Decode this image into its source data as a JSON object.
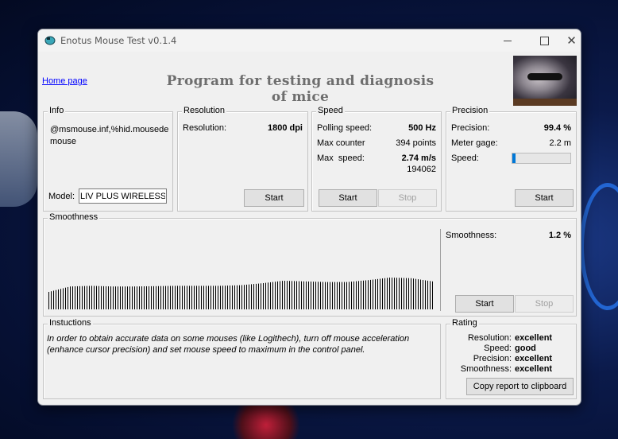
{
  "window": {
    "title": "Enotus Mouse Test v0.1.4",
    "icon": "mouse-icon"
  },
  "header": {
    "home_link": "Home page",
    "headline": "Program for testing and diagnosis of mice",
    "image": "raccoon-photo"
  },
  "info": {
    "title": "Info",
    "device": "@msmouse.inf,%hid.mousede mouse",
    "model_label": "Model:",
    "model_value": "LIV PLUS WIRELESS"
  },
  "resolution": {
    "title": "Resolution",
    "label": "Resolution:",
    "value": "1800 dpi",
    "start": "Start"
  },
  "speed": {
    "title": "Speed",
    "polling_label": "Polling speed:",
    "polling_value": "500 Hz",
    "counter_label": "Max counter",
    "counter_value": "394 points",
    "max_label": "Max  speed:",
    "max_value": "2.74 m/s",
    "max_sub": "194062",
    "start": "Start",
    "stop": "Stop"
  },
  "precision": {
    "title": "Precision",
    "precision_label": "Precision:",
    "precision_value": "99.4 %",
    "gage_label": "Meter gage:",
    "gage_value": "2.2 m",
    "speed_label": "Speed:",
    "speed_level": 0.05,
    "start": "Start"
  },
  "smoothness": {
    "title": "Smoothness",
    "label": "Smoothness:",
    "value": "1.2 %",
    "start": "Start",
    "stop": "Stop",
    "graph_profile": [
      0.55,
      0.72,
      0.74,
      0.72,
      0.72,
      0.73,
      0.74,
      0.74,
      0.74,
      0.76,
      0.82,
      0.9,
      0.88,
      0.86,
      0.86,
      0.92,
      1.0,
      0.98,
      0.88
    ]
  },
  "instructions": {
    "title": "Instuctions",
    "text": "In order to obtain accurate data on some mouses (like Logithech), turn off mouse acceleration (enhance cursor precision) and set mouse speed to maximum in the control panel."
  },
  "rating": {
    "title": "Rating",
    "rows": [
      {
        "label": "Resolution:",
        "value": "excellent"
      },
      {
        "label": "Speed:",
        "value": "good"
      },
      {
        "label": "Precision:",
        "value": "excellent"
      },
      {
        "label": "Smoothness:",
        "value": "excellent"
      }
    ],
    "copy": "Copy report to clipboard"
  },
  "colors": {
    "accent": "#0078d7",
    "link": "#0000ff"
  }
}
